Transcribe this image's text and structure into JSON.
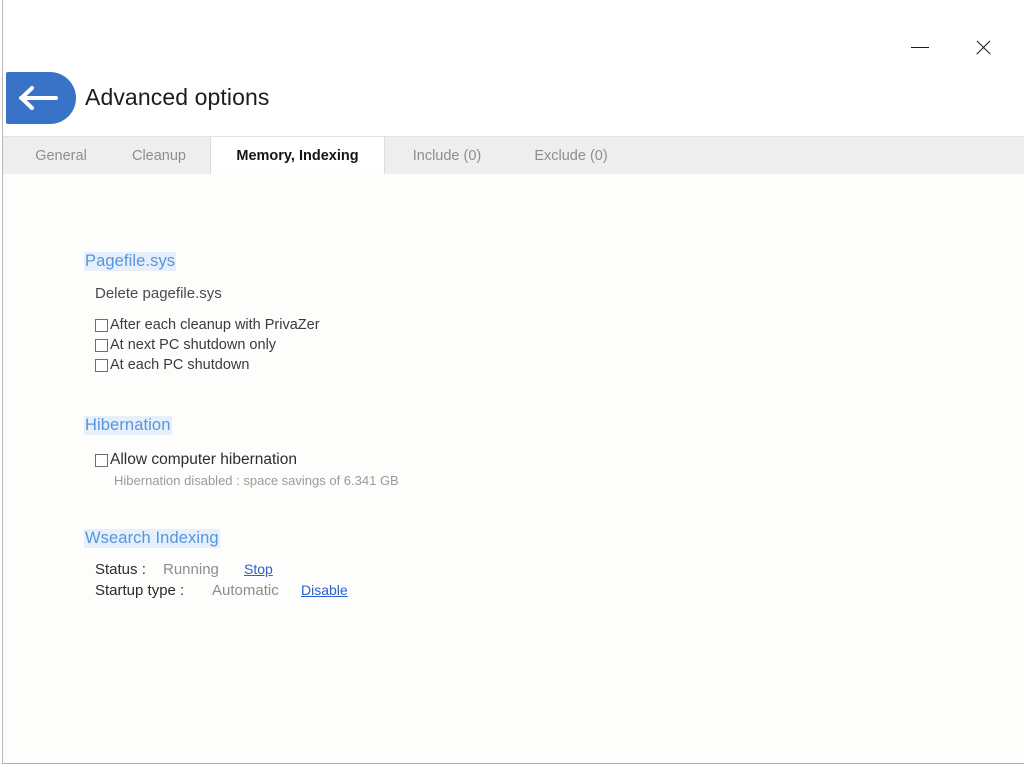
{
  "window": {
    "title": "Advanced options",
    "back_icon": "back-arrow-icon",
    "minimize_label": "–",
    "close_label": "✕",
    "accent_color": "#3973c8",
    "link_color": "#2b5fd0",
    "section_header_color": "#5596e0",
    "section_header_highlight": "#e6effa",
    "tabbar_color": "#eeeeee",
    "content_bg": "#fdfdfb"
  },
  "tabs": [
    {
      "label": "General",
      "active": false
    },
    {
      "label": "Cleanup",
      "active": false
    },
    {
      "label": "Memory, Indexing",
      "active": true
    },
    {
      "label": "Include (0)",
      "active": false
    },
    {
      "label": "Exclude (0)",
      "active": false
    }
  ],
  "sections": {
    "pagefile": {
      "header": "Pagefile.sys",
      "subtitle": "Delete pagefile.sys",
      "options": [
        {
          "label": "After each cleanup with PrivaZer",
          "checked": false
        },
        {
          "label": "At next PC shutdown only",
          "checked": false
        },
        {
          "label": "At each PC shutdown",
          "checked": false
        }
      ]
    },
    "hibernation": {
      "header": "Hibernation",
      "option": {
        "label": "Allow computer hibernation",
        "checked": false
      },
      "note": "Hibernation disabled : space savings of 6.341 GB"
    },
    "wsearch": {
      "header": "Wsearch Indexing",
      "rows": [
        {
          "key": "Status :",
          "value": "Running",
          "action": "Stop"
        },
        {
          "key": "Startup type :",
          "value": "Automatic",
          "action": "Disable"
        }
      ]
    }
  }
}
